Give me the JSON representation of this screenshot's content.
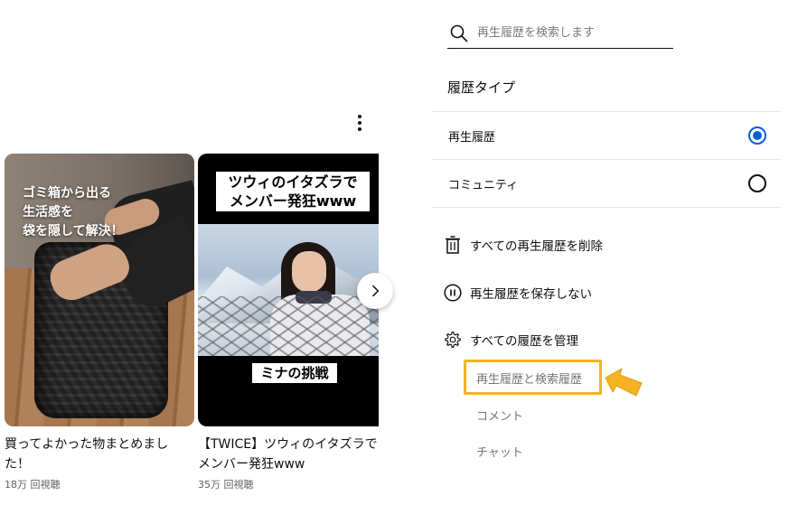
{
  "shelf": {
    "menu_icon": "more-vert-icon",
    "cards": [
      {
        "thumb_caption": "ゴミ箱から出る\n生活感を\n袋を隠して解決！",
        "title": "買ってよかった物まとめました！",
        "views": "18万 回視聴"
      },
      {
        "thumb_top_text": "ツウィのイタズラで\nメンバー発狂www",
        "thumb_bottom_text": "ミナの挑戦",
        "title": "【TWICE】ツウィのイタズラでメンバー発狂www",
        "views": "35万 回視聴"
      }
    ],
    "next_icon": "chevron-right-icon"
  },
  "history": {
    "search_placeholder": "再生履歴を検索します",
    "search_icon": "search-icon",
    "type_title": "履歴タイプ",
    "types": [
      {
        "label": "再生履歴",
        "selected": true
      },
      {
        "label": "コミュニティ",
        "selected": false
      }
    ],
    "actions": [
      {
        "label": "すべての再生履歴を削除",
        "icon": "trash-icon"
      },
      {
        "label": "再生履歴を保存しない",
        "icon": "pause-icon"
      },
      {
        "label": "すべての履歴を管理",
        "icon": "gear-icon"
      }
    ],
    "manage_sub_items": [
      "再生履歴と検索履歴",
      "コメント",
      "チャット"
    ]
  },
  "colors": {
    "accent_blue": "#065fd4",
    "highlight": "#f5b324"
  }
}
